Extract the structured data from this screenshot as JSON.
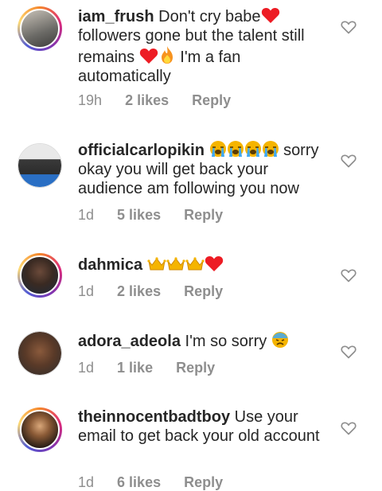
{
  "comments": [
    {
      "username": "iam_frush",
      "text_parts": [
        "Don't cry babe",
        "followers gone but the talent still remains",
        "I'm a fan automatically"
      ],
      "emojis": [
        "red-heart",
        "red-heart",
        "fire"
      ],
      "time": "19h",
      "likes": "2 likes",
      "reply": "Reply",
      "avatar_ring": true
    },
    {
      "username": "officialcarlopikin",
      "text": "sorry okay you will get back your audience am following you now",
      "emojis": [
        "loudly-crying-face",
        "loudly-crying-face",
        "loudly-crying-face",
        "loudly-crying-face"
      ],
      "time": "1d",
      "likes": "5 likes",
      "reply": "Reply",
      "avatar_ring": false
    },
    {
      "username": "dahmica",
      "text": "",
      "emojis": [
        "crown",
        "crown",
        "crown",
        "red-heart"
      ],
      "time": "1d",
      "likes": "2 likes",
      "reply": "Reply",
      "avatar_ring": true
    },
    {
      "username": "adora_adeola",
      "text": "I'm so sorry",
      "emojis": [
        "sad-sweat-face"
      ],
      "time": "1d",
      "likes": "1 like",
      "reply": "Reply",
      "avatar_ring": false
    },
    {
      "username": "theinnocentbadtboy",
      "text": "Use your email to get back your old account",
      "emojis": [],
      "time": "1d",
      "likes": "6 likes",
      "reply": "Reply",
      "avatar_ring": true
    }
  ],
  "colors": {
    "text": "#262626",
    "meta": "#8e8e8e",
    "heart_outline": "#8e8e8e",
    "emoji_red": "#ed1c24",
    "emoji_gold": "#f5b400"
  }
}
